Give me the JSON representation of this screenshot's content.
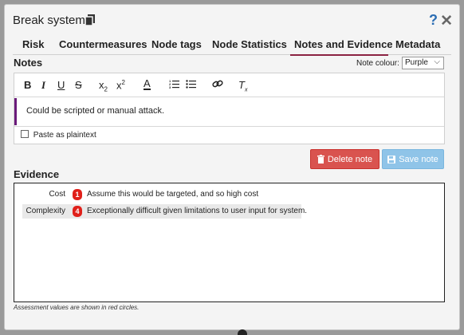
{
  "dialog": {
    "title": "Break system",
    "icons": [
      "copy-icon",
      "help-icon",
      "close-icon"
    ],
    "help_glyph": "?",
    "close_glyph": "✕"
  },
  "tabs": [
    {
      "label": "Risk",
      "active": false
    },
    {
      "label": "Countermeasures",
      "active": false
    },
    {
      "label": "Node tags",
      "active": false
    },
    {
      "label": "Node Statistics",
      "active": false
    },
    {
      "label": "Notes and Evidence",
      "active": true
    },
    {
      "label": "Metadata",
      "active": false
    }
  ],
  "notes": {
    "heading": "Notes",
    "colour_label": "Note colour:",
    "colour_value": "Purple",
    "colour_hex": "#6a1a7a",
    "toolbar": [
      "bold",
      "italic",
      "underline",
      "strikethrough",
      "subscript",
      "superscript",
      "text-color",
      "ordered-list",
      "bullet-list",
      "link",
      "clear-format"
    ],
    "text": "Could be scripted or manual attack.",
    "paste_label": "Paste as plaintext",
    "paste_checked": false
  },
  "buttons": {
    "delete_label": "Delete note",
    "save_label": "Save note"
  },
  "evidence": {
    "heading": "Evidence",
    "rows": [
      {
        "label": "Cost",
        "score": "1",
        "text": "Assume this would be targeted, and so high cost"
      },
      {
        "label": "Complexity",
        "score": "4",
        "text": "Exceptionally difficult given limitations to user input for system."
      }
    ],
    "footnote": "Assessment values are shown in red circles."
  },
  "colors": {
    "accent_tab": "#8b2242",
    "delete": "#d9534f",
    "save": "#8fc4e8",
    "badge": "#e0201a"
  }
}
